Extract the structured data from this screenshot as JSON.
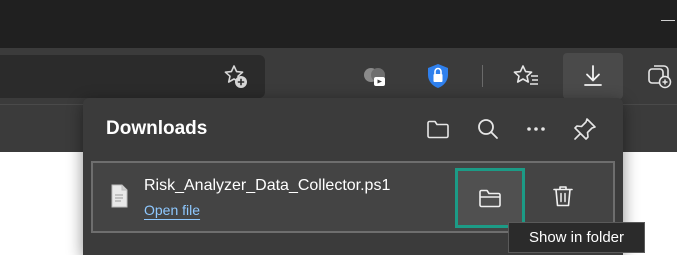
{
  "downloads_panel": {
    "title": "Downloads",
    "header_icons": [
      "folder-icon",
      "search-icon",
      "more-icon",
      "pin-icon"
    ],
    "item": {
      "file_name": "Risk_Analyzer_Data_Collector.ps1",
      "open_link_label": "Open file",
      "actions": [
        "show-in-folder",
        "delete"
      ]
    },
    "tooltip": "Show in folder"
  },
  "toolbar_icons": [
    "favorite-add-icon",
    "extension-icon",
    "vpn-lock-icon",
    "favorites-icon",
    "downloads-icon",
    "collections-icon"
  ],
  "colors": {
    "highlight_border": "#1c9b86",
    "link": "#8ec8ff",
    "flyout_bg": "#3b3b3b",
    "titlebar_bg": "#202020",
    "vpn_icon": "#2f80ed"
  }
}
